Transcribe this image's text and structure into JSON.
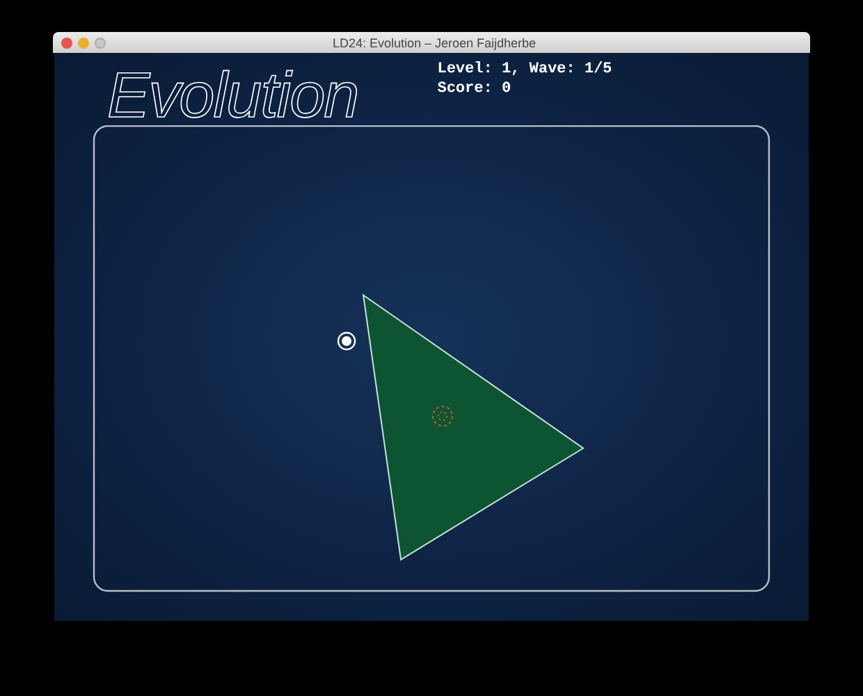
{
  "window": {
    "title": "LD24: Evolution – Jeroen Faijdherbe"
  },
  "game": {
    "title": "Evolution",
    "hud": [
      "Level: 1, Wave: 1/5",
      "Score: 0"
    ]
  }
}
